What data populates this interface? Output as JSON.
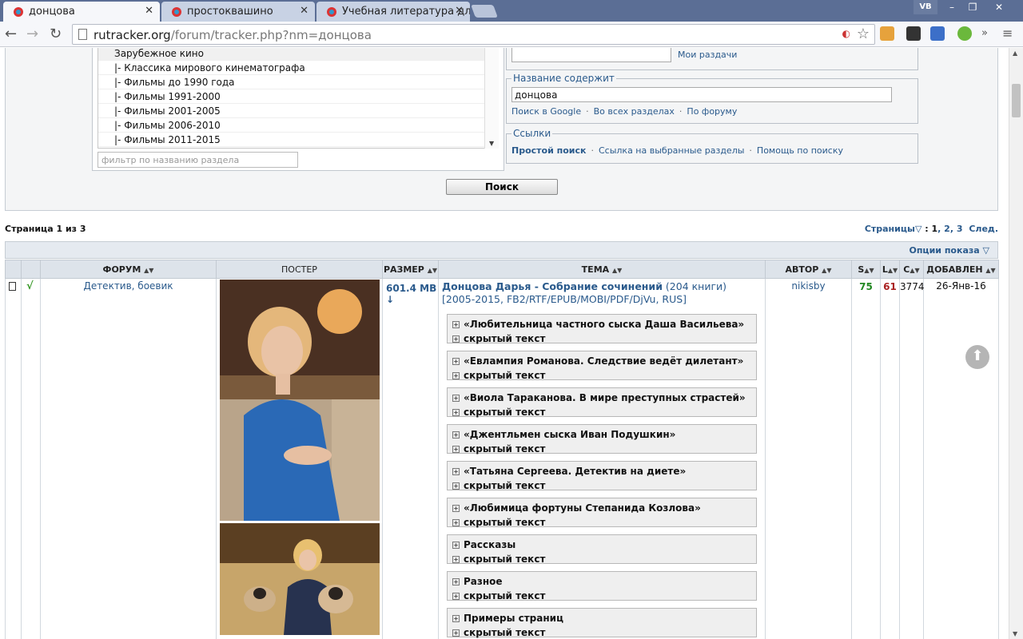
{
  "browser": {
    "tabs": [
      {
        "title": "донцова"
      },
      {
        "title": "простоквашино"
      },
      {
        "title": "Учебная литература для"
      }
    ],
    "url_host": "rutracker.org",
    "url_path": "/forum/tracker.php?nm=донцова",
    "profile_badge": "VB"
  },
  "categories": {
    "group": "Зарубежное кино",
    "items": [
      "|- Классика мирового кинематографа",
      "|- Фильмы до 1990 года",
      "|- Фильмы 1991-2000",
      "|- Фильмы 2001-2005",
      "|- Фильмы 2006-2010",
      "|- Фильмы 2011-2015"
    ],
    "filter_placeholder": "фильтр по названию раздела"
  },
  "my_torrents_link": "Мои раздачи",
  "title_contains": {
    "legend": "Название содержит",
    "value": "донцова",
    "links": [
      "Поиск в Google",
      "Во всех разделах",
      "По форуму"
    ]
  },
  "links_box": {
    "legend": "Ссылки",
    "simple": "Простой поиск",
    "items": [
      "Ссылка на выбранные разделы",
      "Помощь по поиску"
    ]
  },
  "search_button": "Поиск",
  "page_info": "Страница 1 из 3",
  "pager": {
    "label": "Страницы",
    "pages": [
      "1",
      "2",
      "3"
    ],
    "next": "След."
  },
  "options_label": "Опции показа",
  "columns": {
    "forum": "ФОРУМ",
    "poster": "ПОСТЕР",
    "size": "РАЗМЕР",
    "topic": "ТЕМА",
    "author": "АВТОР",
    "seeds": "S",
    "leech": "L",
    "completed": "C",
    "added": "ДОБАВЛЕН"
  },
  "row": {
    "forum": "Детектив, боевик",
    "size": "601.4 MB ↓",
    "title_bold": "Донцова Дарья - Собрание сочинений",
    "title_rest": " (204 книги) [2005-2015, FB2/RTF/EPUB/MOBI/PDF/DjVu, RUS]",
    "author": "nikisby",
    "seeds": "75",
    "leech": "61",
    "completed": "3774",
    "added": "26-Янв-16",
    "spoilers": [
      {
        "title": "«Любительница частного сыска Даша Васильева»",
        "hidden": "скрытый текст"
      },
      {
        "title": "«Евлампия Романова. Следствие ведёт дилетант»",
        "hidden": "скрытый текст"
      },
      {
        "title": "«Виола Тараканова. В мире преступных страстей»",
        "hidden": "скрытый текст"
      },
      {
        "title": "«Джентльмен сыска Иван Подушкин»",
        "hidden": "скрытый текст"
      },
      {
        "title": "«Татьяна Сергеева. Детектив на диете»",
        "hidden": "скрытый текст"
      },
      {
        "title": "«Любимица фортуны Степанида Козлова»",
        "hidden": "скрытый текст"
      },
      {
        "title": "Рассказы",
        "hidden": "скрытый текст"
      },
      {
        "title": "Разное",
        "hidden": "скрытый текст"
      },
      {
        "title": "Примеры страниц",
        "hidden": "скрытый текст"
      }
    ]
  }
}
